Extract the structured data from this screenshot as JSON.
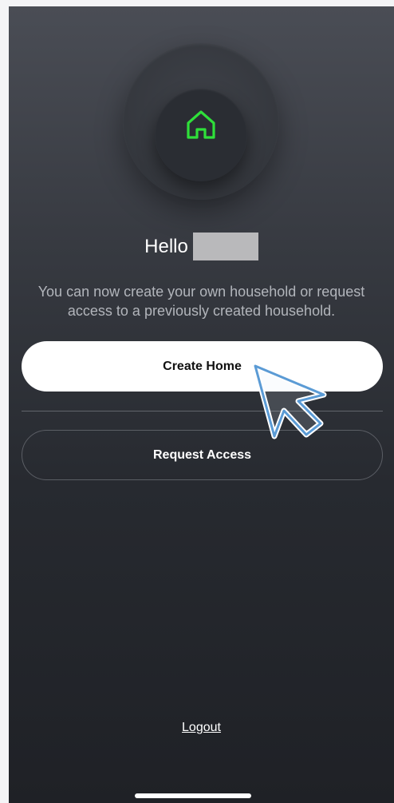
{
  "header": {
    "icon": "home-icon",
    "icon_color": "#2fe03a",
    "greeting": "Hello",
    "name_redacted": true
  },
  "main": {
    "description": "You can now create your own household or request access to a previously created household.",
    "create_home_label": "Create Home",
    "request_access_label": "Request Access"
  },
  "footer": {
    "logout_label": "Logout"
  },
  "colors": {
    "background_top": "#4a4d55",
    "background_bottom": "#1f2126",
    "primary_button_bg": "#ffffff",
    "accent_green": "#2fe03a",
    "cursor_outline": "#5b9bd5"
  }
}
